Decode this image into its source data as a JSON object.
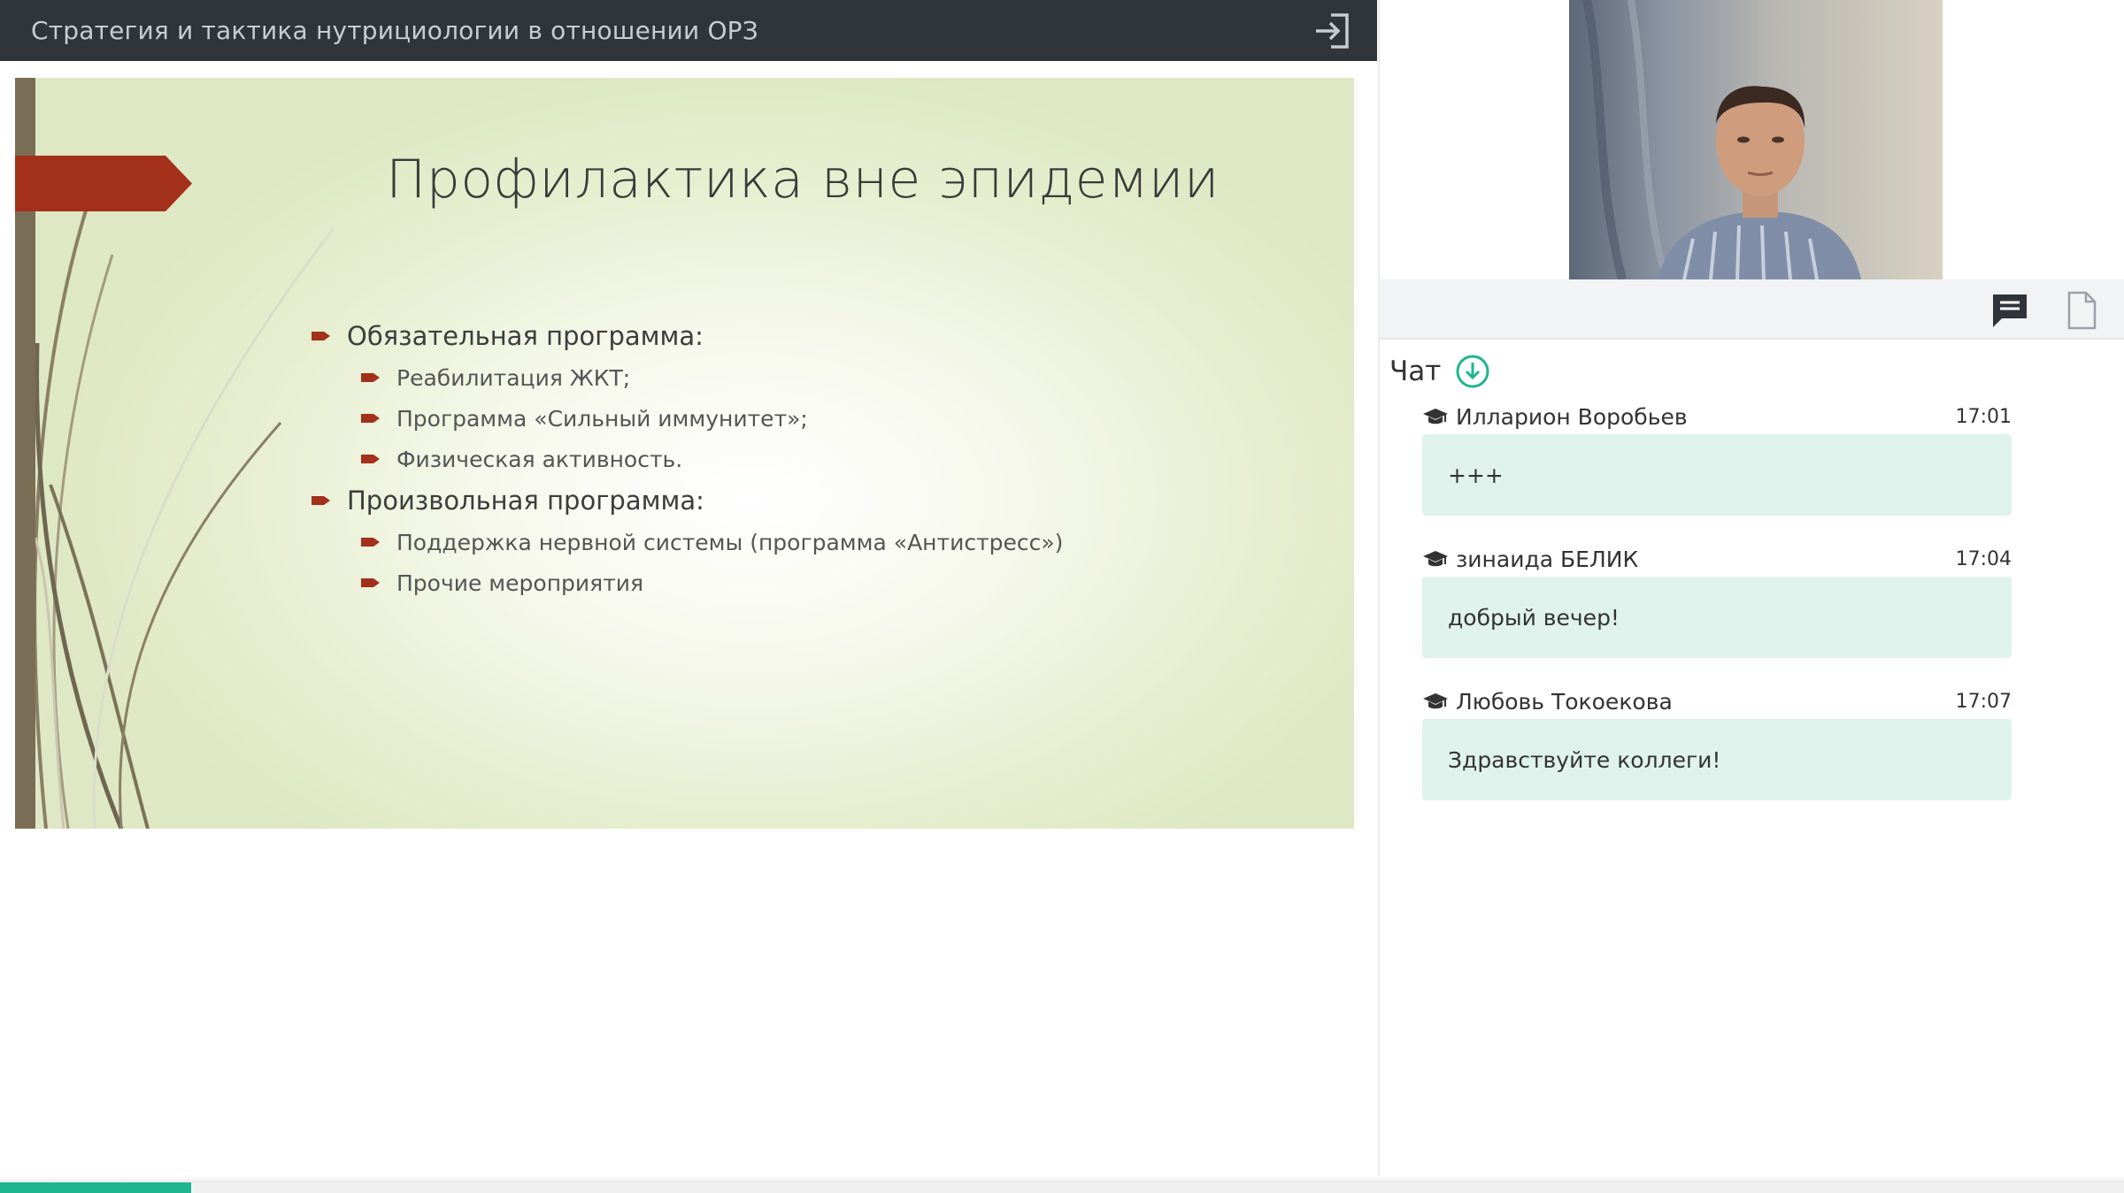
{
  "topbar": {
    "title": "Стратегия и тактика нутрициологии в отношении ОРЗ",
    "exit_icon": "exit-icon"
  },
  "slide": {
    "title": "Профилактика вне эпидемии",
    "items": [
      {
        "level": 1,
        "text": "Обязательная программа:"
      },
      {
        "level": 2,
        "text": "Реабилитация ЖКТ;"
      },
      {
        "level": 2,
        "text": "Программа «Сильный иммунитет»;"
      },
      {
        "level": 2,
        "text": "Физическая активность."
      },
      {
        "level": 1,
        "text": "Произвольная программа:"
      },
      {
        "level": 2,
        "text": "Поддержка нервной системы (программа «Антистресс»)"
      },
      {
        "level": 2,
        "text": "Прочие мероприятия"
      }
    ],
    "colors": {
      "accent": "#a3301a",
      "bar": "#7a6d55"
    }
  },
  "tabs": {
    "chat_icon": "chat-icon",
    "files_icon": "document-icon"
  },
  "chat": {
    "title": "Чат",
    "messages": [
      {
        "author": "Илларион Воробьев",
        "time": "17:01",
        "text": "+++"
      },
      {
        "author": "зинаида БЕЛИК",
        "time": "17:04",
        "text": "добрый вечер!"
      },
      {
        "author": "Любовь Токоекова",
        "time": "17:07",
        "text": "Здравствуйте коллеги!"
      }
    ]
  },
  "progress": {
    "fraction": 0.09,
    "color": "#1fb58f"
  }
}
